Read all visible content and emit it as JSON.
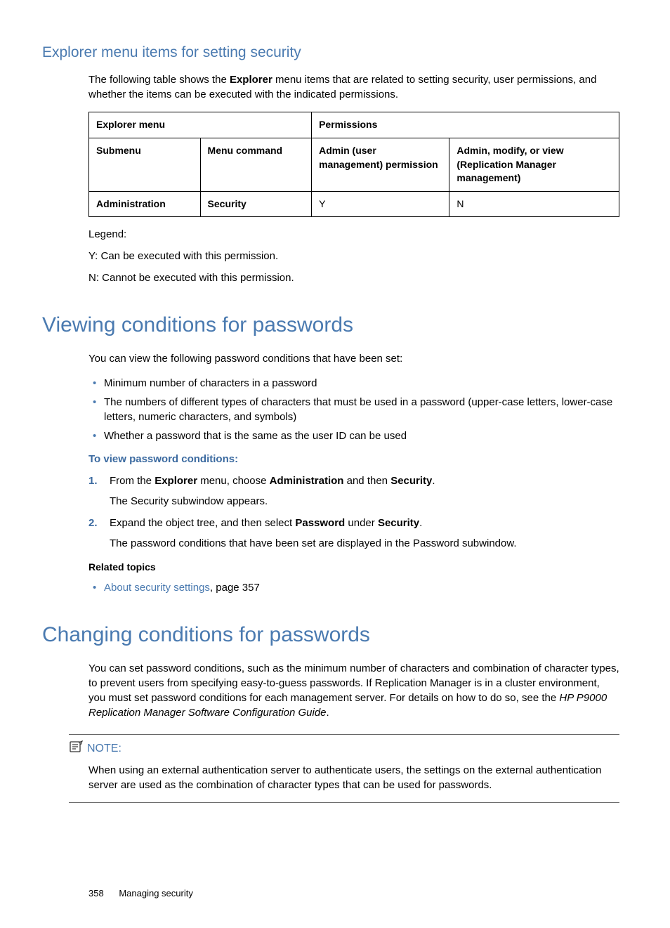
{
  "section1": {
    "heading": "Explorer menu items for setting security",
    "intro_pre": "The following table shows the ",
    "intro_bold": "Explorer",
    "intro_post": " menu items that are related to setting security, user permissions, and whether the items can be executed with the indicated permissions.",
    "table": {
      "hdr_explorer": "Explorer menu",
      "hdr_permissions": "Permissions",
      "hdr_submenu": "Submenu",
      "hdr_menucmd": "Menu command",
      "hdr_admin": "Admin (user management) permission",
      "hdr_modview": "Admin, modify, or view (Replication Manager management)",
      "row_sub": "Administration",
      "row_cmd": "Security",
      "row_admin": "Y",
      "row_modview": "N"
    },
    "legend": "Legend:",
    "legend_y": "Y: Can be executed with this permission.",
    "legend_n": "N: Cannot be executed with this permission."
  },
  "section2": {
    "heading": "Viewing conditions for passwords",
    "intro": "You can view the following password conditions that have been set:",
    "bullets": [
      "Minimum number of characters in a password",
      "The numbers of different types of characters that must be used in a password (upper-case letters, lower-case letters, numeric characters, and symbols)",
      "Whether a password that is the same as the user ID can be used"
    ],
    "proc_heading": "To view password conditions:",
    "steps": {
      "s1_pre": "From the ",
      "s1_b1": "Explorer",
      "s1_mid1": " menu, choose ",
      "s1_b2": "Administration",
      "s1_mid2": " and then ",
      "s1_b3": "Security",
      "s1_end": ".",
      "s1_sub": "The Security subwindow appears.",
      "s2_pre": "Expand the object tree, and then select ",
      "s2_b1": "Password",
      "s2_mid": " under ",
      "s2_b2": "Security",
      "s2_end": ".",
      "s2_sub": "The password conditions that have been set are displayed in the Password subwindow."
    },
    "related_heading": "Related topics",
    "related_link": "About security settings",
    "related_suffix": ", page 357"
  },
  "section3": {
    "heading": "Changing conditions for passwords",
    "intro_pre": "You can set password conditions, such as the minimum number of characters and combination of character types, to prevent users from specifying easy-to-guess passwords. If Replication Manager is in a cluster environment, you must set password conditions for each management server. For details on how to do so, see the ",
    "intro_it": "HP P9000 Replication Manager Software Configuration Guide",
    "intro_post": ".",
    "note_label": "NOTE:",
    "note_body": "When using an external authentication server to authenticate users, the settings on the external authentication server are used as the combination of character types that can be used for passwords."
  },
  "footer": {
    "page": "358",
    "title": "Managing security"
  }
}
